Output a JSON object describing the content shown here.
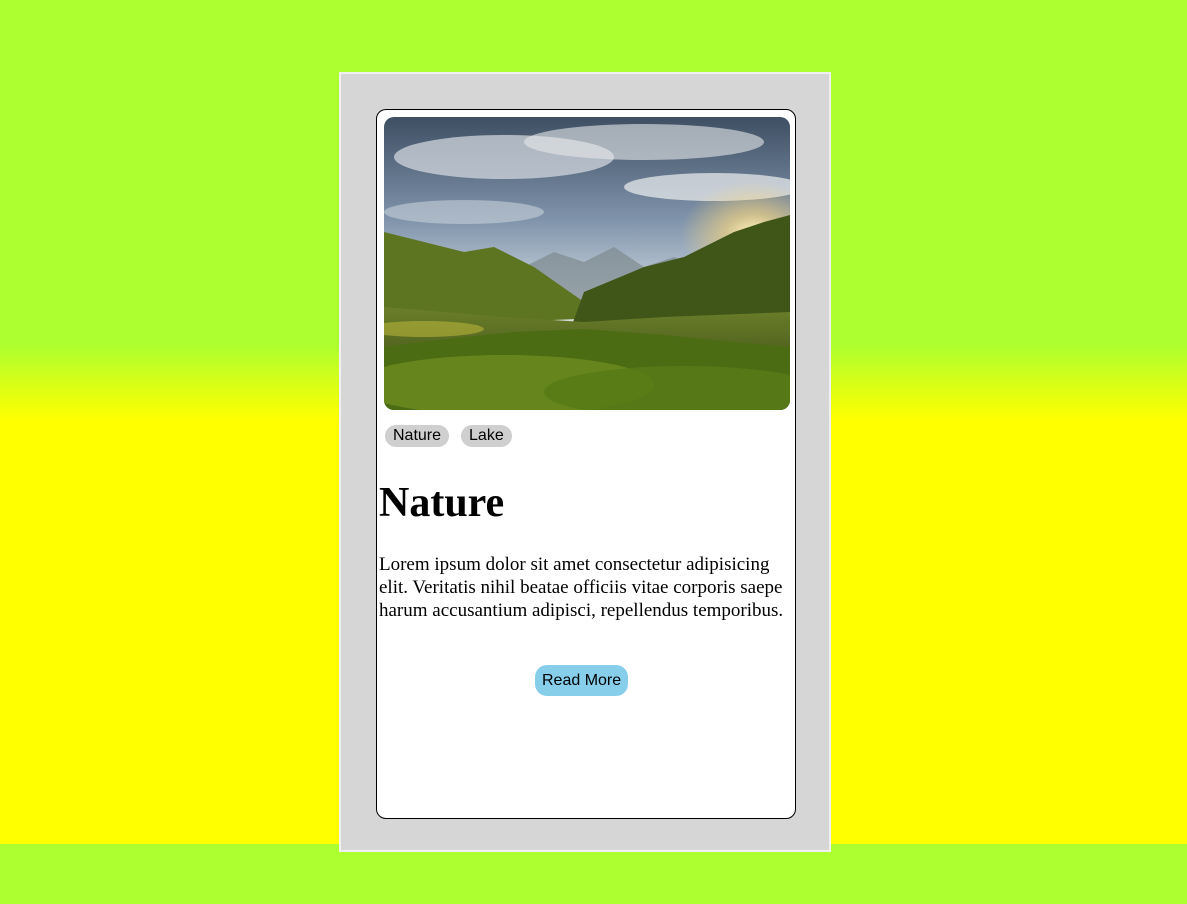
{
  "card": {
    "image_alt": "mountain-valley-sunset-landscape",
    "tags": [
      "Nature",
      "Lake"
    ],
    "title": "Nature",
    "description": "Lorem ipsum dolor sit amet consectetur adipisicing elit. Veritatis nihil beatae officiis vitae corporis saepe harum accusantium adipisci, repellendus temporibus.",
    "button_label": "Read More"
  },
  "colors": {
    "page_background_top": "#adff2f",
    "page_background_middle": "#ffff00",
    "frame_background": "#d6d6d6",
    "card_background": "#ffffff",
    "tag_background": "#cfcfcf",
    "button_background": "#87ceeb"
  }
}
